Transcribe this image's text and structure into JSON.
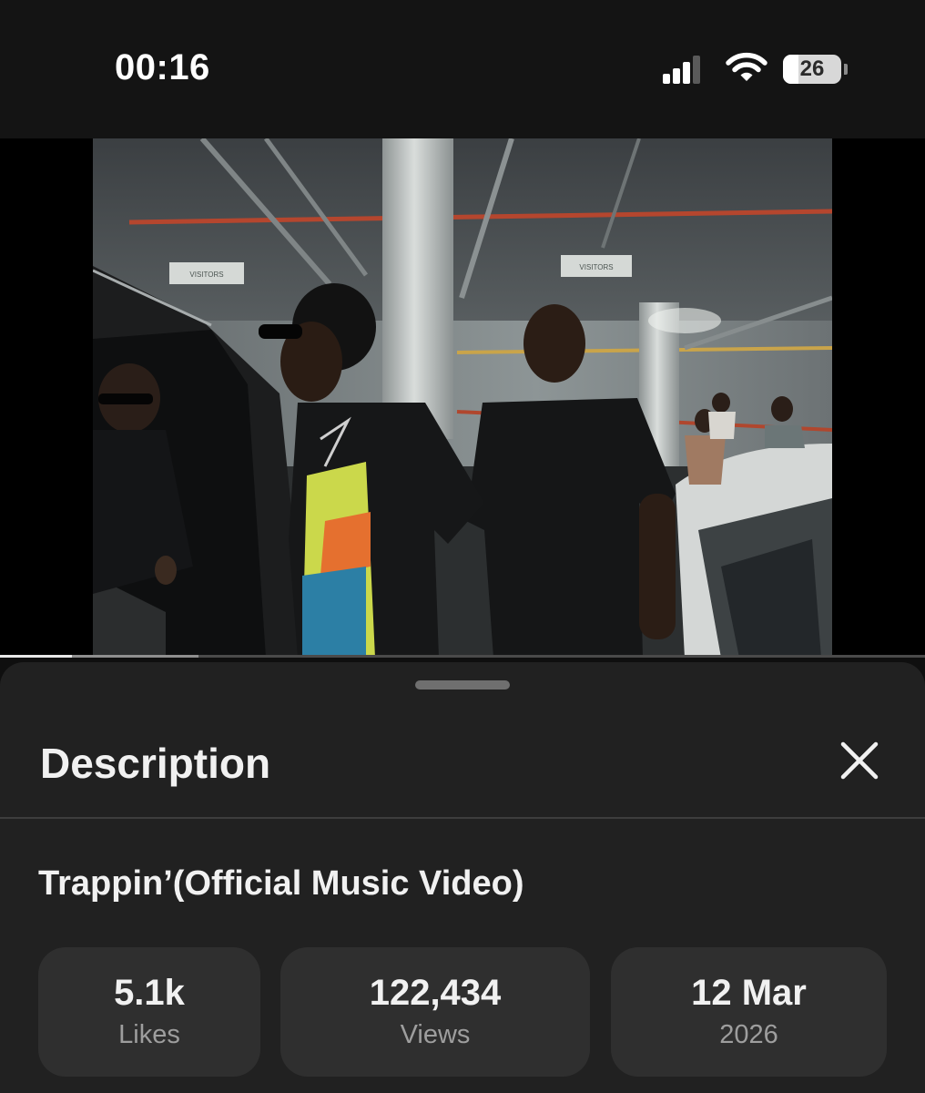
{
  "status_bar": {
    "time": "00:16",
    "battery_level": "26",
    "signal_bars_active": 3,
    "icons": [
      "cellular-signal-icon",
      "wifi-icon",
      "battery-icon"
    ]
  },
  "player": {
    "progress_played_fraction": 0.078,
    "progress_buffered_fraction": 0.215,
    "frame_signs": [
      "VISITORS",
      "VISITORS"
    ]
  },
  "description_panel": {
    "heading": "Description",
    "close_icon": "close-icon",
    "video_title": "Trappin’(Official Music Video)",
    "stats": [
      {
        "value": "5.1k",
        "label": "Likes"
      },
      {
        "value": "122,434",
        "label": "Views"
      },
      {
        "value": "12 Mar",
        "label": "2026"
      }
    ]
  },
  "colors": {
    "background": "#0f0f0f",
    "sheet": "#212121",
    "stat_card": "#2f2f2f",
    "text_primary": "#f1f1f1",
    "text_secondary": "#9e9e9e",
    "progress_played": "#e8e8e8"
  }
}
